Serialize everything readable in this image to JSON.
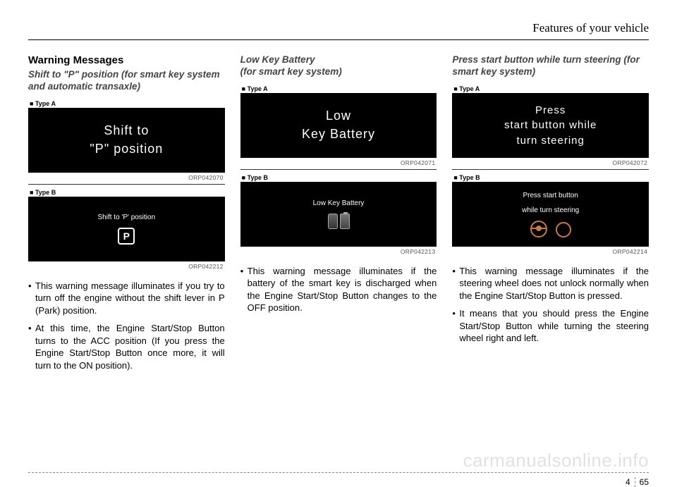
{
  "header": {
    "title": "Features of your vehicle"
  },
  "col1": {
    "heading": "Warning Messages",
    "subheading": "Shift to \"P\" position (for smart key system and automatic transaxle)",
    "panelA": {
      "label": "■ Type A",
      "line1": "Shift to",
      "line2": "\"P\" position",
      "code": "ORP042070"
    },
    "panelB": {
      "label": "■ Type B",
      "line1": "Shift to 'P' position",
      "code": "ORP042212"
    },
    "bullets": [
      "This warning message illuminates if you try to turn off the engine without the shift lever in P (Park) position.",
      "At this time, the Engine Start/Stop Button turns to the ACC position (If you press the Engine Start/Stop Button once more, it will turn to the ON position)."
    ]
  },
  "col2": {
    "subheading": "Low Key Battery\n(for smart key system)",
    "panelA": {
      "label": "■ Type A",
      "line1": "Low",
      "line2": "Key Battery",
      "code": "ORP042071"
    },
    "panelB": {
      "label": "■ Type B",
      "line1": "Low Key Battery",
      "code": "ORP042213"
    },
    "bullets": [
      "This warning message illuminates if the battery of the smart key is discharged when the Engine Start/Stop Button changes to the OFF position."
    ]
  },
  "col3": {
    "subheading": "Press start button while turn steering (for smart key system)",
    "panelA": {
      "label": "■ Type A",
      "line1": "Press",
      "line2": "start button while",
      "line3": "turn steering",
      "code": "ORP042072"
    },
    "panelB": {
      "label": "■ Type B",
      "line1": "Press start button",
      "line2": "while turn steering",
      "code": "ORP042214"
    },
    "bullets": [
      "This warning message illuminates if the steering wheel does not unlock normally when the Engine Start/Stop Button is pressed.",
      "It means that you should press the Engine Start/Stop Button while turning the steering wheel right and left."
    ]
  },
  "footer": {
    "section": "4",
    "page": "65"
  },
  "watermark": "carmanualsonline.info"
}
